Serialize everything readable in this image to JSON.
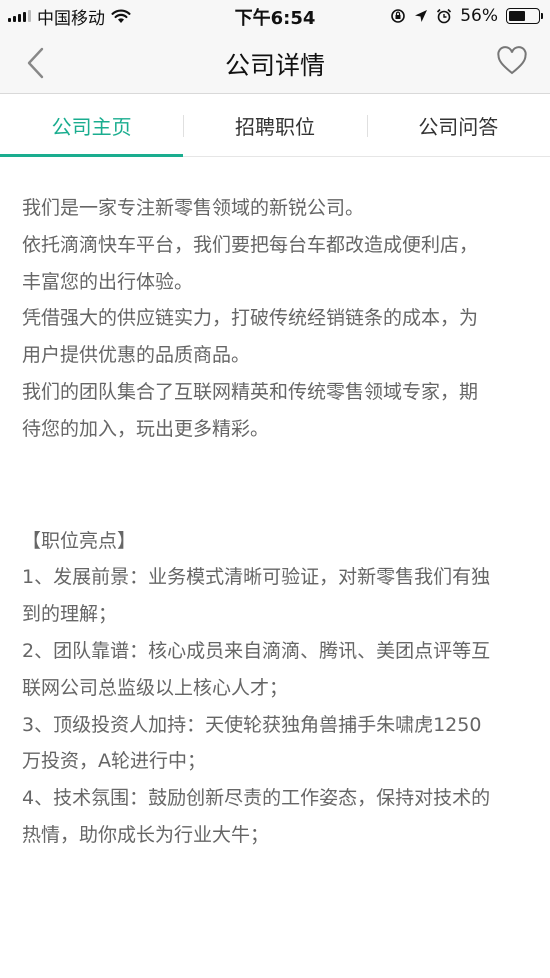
{
  "status_bar": {
    "carrier": "中国移动",
    "time": "下午6:54",
    "battery_percent": "56%",
    "battery_level": 0.56
  },
  "nav": {
    "title": "公司详情",
    "icons": {
      "back": "back-chevron-icon",
      "favorite": "heart-icon"
    }
  },
  "tabs": [
    {
      "label": "公司主页",
      "active": true
    },
    {
      "label": "招聘职位",
      "active": false
    },
    {
      "label": "公司问答",
      "active": false
    }
  ],
  "intro": {
    "lines": [
      "我们是一家专注新零售领域的新锐公司。",
      "依托滴滴快车平台，我们要把每台车都改造成便利店，",
      "丰富您的出行体验。",
      "凭借强大的供应链实力，打破传统经销链条的成本，为",
      "用户提供优惠的品质商品。",
      "我们的团队集合了互联网精英和传统零售领域专家，期",
      "待您的加入，玩出更多精彩。"
    ]
  },
  "highlights": {
    "title": "【职位亮点】",
    "lines": [
      "1、发展前景：业务模式清晰可验证，对新零售我们有独",
      "到的理解；",
      "2、团队靠谱：核心成员来自滴滴、腾讯、美团点评等互",
      "联网公司总监级以上核心人才；",
      "3、顶级投资人加持：天使轮获独角兽捕手朱啸虎1250",
      "万投资，A轮进行中；",
      "4、技术氛围：鼓励创新尽责的工作姿态，保持对技术的",
      "热情，助你成长为行业大牛；"
    ]
  },
  "colors": {
    "accent": "#1aad8f",
    "body_text": "#666666",
    "bar_bg": "#f7f7f7"
  }
}
